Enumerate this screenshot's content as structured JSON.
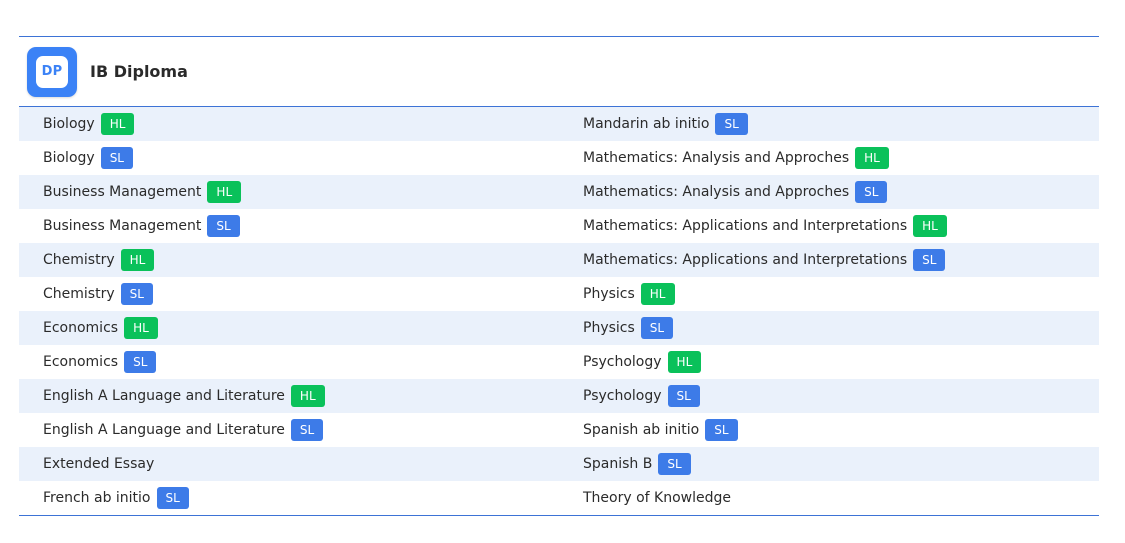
{
  "header": {
    "logo_text": "DP",
    "title": "IB Diploma"
  },
  "colors": {
    "accent": "#3d73d6",
    "hl_badge": "#0ac15a",
    "sl_badge": "#3d7be8",
    "row_alt": "#eaf1fb"
  },
  "rows": [
    {
      "left": {
        "name": "Biology",
        "level": "HL"
      },
      "right": {
        "name": "Mandarin ab initio",
        "level": "SL"
      }
    },
    {
      "left": {
        "name": "Biology",
        "level": "SL"
      },
      "right": {
        "name": "Mathematics: Analysis and Approches",
        "level": "HL"
      }
    },
    {
      "left": {
        "name": "Business Management",
        "level": "HL"
      },
      "right": {
        "name": "Mathematics: Analysis and Approches",
        "level": "SL"
      }
    },
    {
      "left": {
        "name": "Business Management",
        "level": "SL"
      },
      "right": {
        "name": "Mathematics: Applications and Interpretations",
        "level": "HL"
      }
    },
    {
      "left": {
        "name": "Chemistry",
        "level": "HL"
      },
      "right": {
        "name": "Mathematics: Applications and Interpretations",
        "level": "SL"
      }
    },
    {
      "left": {
        "name": "Chemistry",
        "level": "SL"
      },
      "right": {
        "name": "Physics",
        "level": "HL"
      }
    },
    {
      "left": {
        "name": "Economics",
        "level": "HL"
      },
      "right": {
        "name": "Physics",
        "level": "SL"
      }
    },
    {
      "left": {
        "name": "Economics",
        "level": "SL"
      },
      "right": {
        "name": "Psychology",
        "level": "HL"
      }
    },
    {
      "left": {
        "name": "English A Language and Literature",
        "level": "HL"
      },
      "right": {
        "name": "Psychology",
        "level": "SL"
      }
    },
    {
      "left": {
        "name": "English A Language and Literature",
        "level": "SL"
      },
      "right": {
        "name": "Spanish ab initio",
        "level": "SL"
      }
    },
    {
      "left": {
        "name": "Extended Essay",
        "level": ""
      },
      "right": {
        "name": "Spanish B",
        "level": "SL"
      }
    },
    {
      "left": {
        "name": "French ab initio",
        "level": "SL"
      },
      "right": {
        "name": "Theory of Knowledge",
        "level": ""
      }
    }
  ]
}
